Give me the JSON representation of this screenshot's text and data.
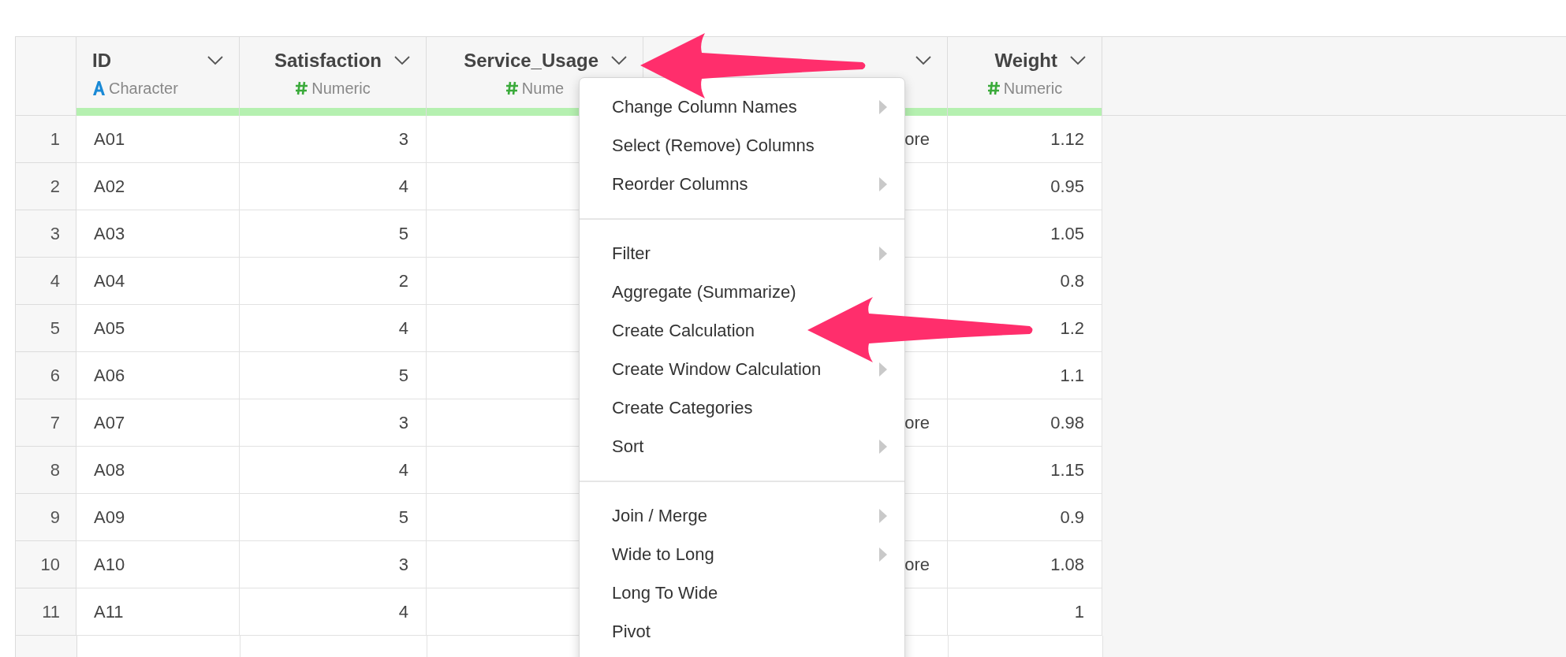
{
  "table": {
    "columns": [
      {
        "title": "ID",
        "type": {
          "kind": "character",
          "label": "Character"
        }
      },
      {
        "title": "Satisfaction",
        "type": {
          "kind": "numeric",
          "label": "Numeric"
        }
      },
      {
        "title": "Service_Usage",
        "type": {
          "kind": "numeric",
          "label": "Nume"
        }
      },
      {},
      {
        "title": "Weight",
        "type": {
          "kind": "numeric",
          "label": "Numeric"
        }
      }
    ],
    "rows": [
      {
        "number": "1",
        "cells": [
          "A01",
          "3",
          null,
          "ore",
          "1.12"
        ]
      },
      {
        "number": "2",
        "cells": [
          "A02",
          "4",
          null,
          null,
          "0.95"
        ]
      },
      {
        "number": "3",
        "cells": [
          "A03",
          "5",
          null,
          null,
          "1.05"
        ]
      },
      {
        "number": "4",
        "cells": [
          "A04",
          "2",
          null,
          null,
          "0.8"
        ]
      },
      {
        "number": "5",
        "cells": [
          "A05",
          "4",
          null,
          null,
          "1.2"
        ]
      },
      {
        "number": "6",
        "cells": [
          "A06",
          "5",
          null,
          null,
          "1.1"
        ]
      },
      {
        "number": "7",
        "cells": [
          "A07",
          "3",
          null,
          "ore",
          "0.98"
        ]
      },
      {
        "number": "8",
        "cells": [
          "A08",
          "4",
          null,
          null,
          "1.15"
        ]
      },
      {
        "number": "9",
        "cells": [
          "A09",
          "5",
          null,
          null,
          "0.9"
        ]
      },
      {
        "number": "10",
        "cells": [
          "A10",
          "3",
          null,
          "ore",
          "1.08"
        ]
      },
      {
        "number": "11",
        "cells": [
          "A11",
          "4",
          null,
          null,
          "1"
        ]
      }
    ]
  },
  "menu": {
    "items": [
      {
        "kind": "item",
        "label": "Change Column Names",
        "submenu": true
      },
      {
        "kind": "item",
        "label": "Select (Remove) Columns",
        "submenu": false
      },
      {
        "kind": "item",
        "label": "Reorder Columns",
        "submenu": true
      },
      {
        "kind": "separator"
      },
      {
        "kind": "item",
        "label": "Filter",
        "submenu": true
      },
      {
        "kind": "item",
        "label": "Aggregate (Summarize)",
        "submenu": false
      },
      {
        "kind": "item",
        "label": "Create Calculation",
        "submenu": false
      },
      {
        "kind": "item",
        "label": "Create Window Calculation",
        "submenu": true
      },
      {
        "kind": "item",
        "label": "Create Categories",
        "submenu": false
      },
      {
        "kind": "item",
        "label": "Sort",
        "submenu": true
      },
      {
        "kind": "separator"
      },
      {
        "kind": "item",
        "label": "Join / Merge",
        "submenu": true
      },
      {
        "kind": "item",
        "label": "Wide to Long",
        "submenu": true
      },
      {
        "kind": "item",
        "label": "Long To Wide",
        "submenu": false
      },
      {
        "kind": "item",
        "label": "Pivot",
        "submenu": false
      }
    ]
  },
  "annotations": [
    {
      "kind": "arrow"
    },
    {
      "kind": "arrow"
    }
  ]
}
